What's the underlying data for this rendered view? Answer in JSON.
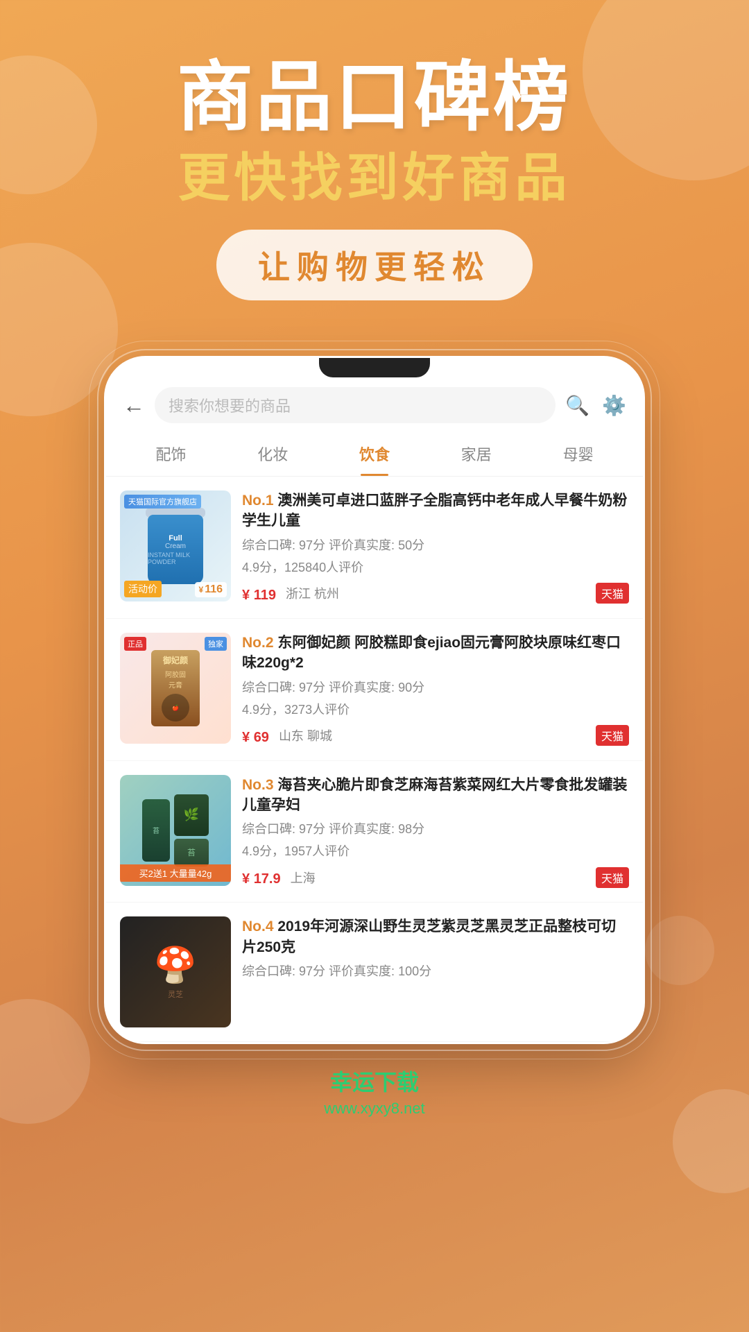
{
  "hero": {
    "title": "商品口碑榜",
    "subtitle": "更快找到好商品",
    "tag": "让购物更轻松"
  },
  "search": {
    "placeholder": "搜索你想要的商品",
    "back_label": "←"
  },
  "tabs": [
    {
      "label": "配饰",
      "active": false
    },
    {
      "label": "化妆",
      "active": false
    },
    {
      "label": "饮食",
      "active": true
    },
    {
      "label": "家居",
      "active": false
    },
    {
      "label": "母婴",
      "active": false
    }
  ],
  "products": [
    {
      "rank": "No.1",
      "title": "澳洲美可卓进口蓝胖子全脂高钙中老年成人早餐牛奶粉学生儿童",
      "composite_score": "97分",
      "authenticity_score": "50分",
      "rating": "4.9分",
      "review_count": "125840人评价",
      "price": "119",
      "original_price": "116",
      "origin": "浙江 杭州",
      "platform": "天猫",
      "activity": "天猫国际官方旗舰店",
      "activity_price_label": "活动价",
      "img_color": "blue"
    },
    {
      "rank": "No.2",
      "title": "东阿御妃颜 阿胶糕即食ejiao固元膏阿胶块原味红枣口味220g*2",
      "composite_score": "97分",
      "authenticity_score": "90分",
      "rating": "4.9分",
      "review_count": "3273人评价",
      "price": "69",
      "origin": "山东 聊城",
      "platform": "天猫",
      "img_color": "pink"
    },
    {
      "rank": "No.3",
      "title": "海苔夹心脆片即食芝麻海苔紫菜网红大片零食批发罐装儿童孕妇",
      "composite_score": "97分",
      "authenticity_score": "98分",
      "rating": "4.9分",
      "review_count": "1957人评价",
      "price": "17.9",
      "origin": "上海",
      "platform": "天猫",
      "img_color": "green",
      "buy_label": "买2送1 大量量42g"
    },
    {
      "rank": "No.4",
      "title": "2019年河源深山野生灵芝紫灵芝黑灵芝正品整枝可切片250克",
      "composite_score": "97分",
      "authenticity_score": "100分",
      "rating": "",
      "review_count": "",
      "price": "",
      "origin": "",
      "platform": "",
      "img_color": "dark"
    }
  ],
  "bottom_brand": {
    "main": "幸运下载",
    "sub": "www.xyxy8.net"
  }
}
